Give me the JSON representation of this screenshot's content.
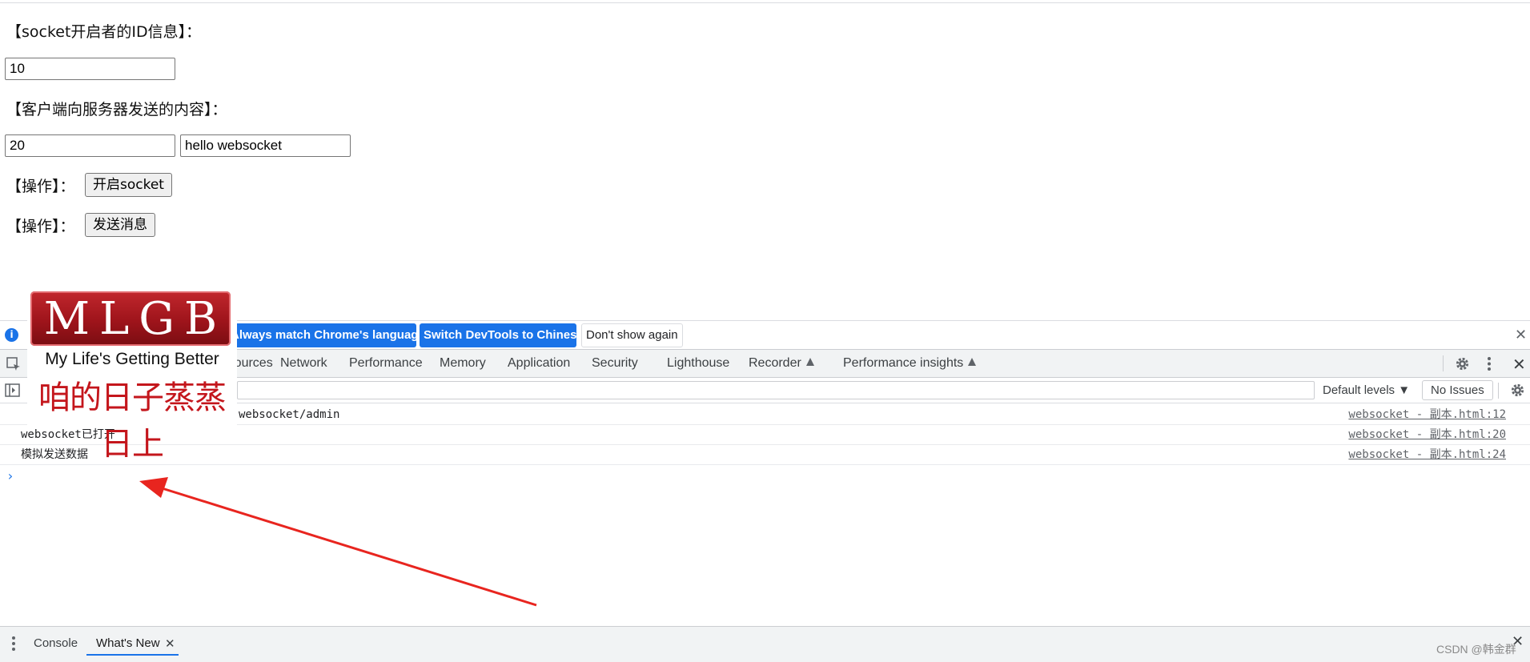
{
  "page": {
    "id_label": "【socket开启者的ID信息】：",
    "id_value": "10",
    "content_label": "【客户端向服务器发送的内容】：",
    "content_id_value": "20",
    "content_msg_value": "hello websocket",
    "op_label_1": "【操作】：",
    "open_socket_button": "开启socket",
    "op_label_2": "【操作】：",
    "send_message_button": "发送消息"
  },
  "logo": {
    "mark": "MLGB",
    "slogan": "My Life's Getting Better",
    "chinese": "咱的日子蒸蒸日上"
  },
  "infobar": {
    "match_language_button": "Always match Chrome's language",
    "switch_chinese_button": "Switch DevTools to Chinese",
    "dont_show_button": "Don't show again"
  },
  "tabs": {
    "sources": "Sources",
    "network": "Network",
    "performance": "Performance",
    "memory": "Memory",
    "application": "Application",
    "security": "Security",
    "lighthouse": "Lighthouse",
    "recorder": "Recorder",
    "performance_insights": "Performance insights"
  },
  "console_toolbar": {
    "levels": "Default levels ▼",
    "issues": "No Issues"
  },
  "logs": [
    {
      "message": "websocket/admin",
      "source": "websocket - 副本.html:12"
    },
    {
      "message": "websocket已打开",
      "source": "websocket - 副本.html:20"
    },
    {
      "message": "模拟发送数据",
      "source": "websocket - 副本.html:24"
    }
  ],
  "drawer": {
    "console_tab": "Console",
    "whats_new_tab": "What's New"
  },
  "watermark": "CSDN @韩金群",
  "colors": {
    "devtools_blue": "#1a73e8",
    "arrow_red": "#e8251f",
    "logo_red": "#c1272d"
  }
}
